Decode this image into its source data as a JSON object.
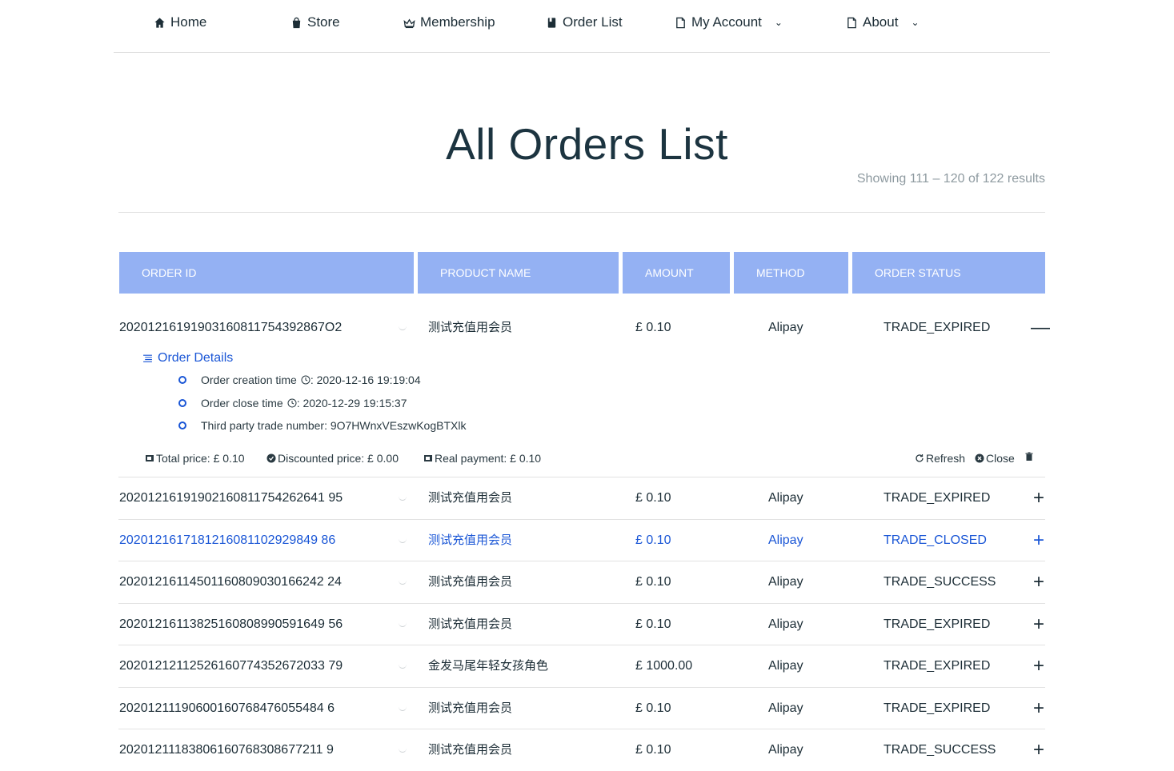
{
  "nav": {
    "home": "Home",
    "store": "Store",
    "membership": "Membership",
    "order_list": "Order List",
    "my_account": "My Account",
    "about": "About"
  },
  "page": {
    "title": "All Orders List",
    "showing": "Showing 111 – 120 of 122 results"
  },
  "table": {
    "headers": [
      "ORDER ID",
      "PRODUCT NAME",
      "AMOUNT",
      "METHOD",
      "ORDER STATUS"
    ],
    "rows": [
      {
        "id": "20201216191903160811754392867O2",
        "product": "测试充值用会员",
        "amount": "£ 0.10",
        "method": "Alipay",
        "status": "TRADE_EXPIRED",
        "toggle": "—"
      },
      {
        "id": "20201216191902160811754262641 95",
        "product": "测试充值用会员",
        "amount": "£ 0.10",
        "method": "Alipay",
        "status": "TRADE_EXPIRED",
        "toggle": "+"
      },
      {
        "id": "2020121617181216081102929849 86",
        "product": "测试充值用会员",
        "amount": "£ 0.10",
        "method": "Alipay",
        "status": "TRADE_CLOSED",
        "toggle": "+"
      },
      {
        "id": "20201216114501160809030166242 24",
        "product": "测试充值用会员",
        "amount": "£ 0.10",
        "method": "Alipay",
        "status": "TRADE_SUCCESS",
        "toggle": "+"
      },
      {
        "id": "20201216113825160808990591649 56",
        "product": "测试充值用会员",
        "amount": "£ 0.10",
        "method": "Alipay",
        "status": "TRADE_EXPIRED",
        "toggle": "+"
      },
      {
        "id": "20201212112526160774352672033 79",
        "product": "金发马尾年轻女孩角色",
        "amount": "£ 1000.00",
        "method": "Alipay",
        "status": "TRADE_EXPIRED",
        "toggle": "+"
      },
      {
        "id": "20201211190600160768476055484 6",
        "product": "测试充值用会员",
        "amount": "£ 0.10",
        "method": "Alipay",
        "status": "TRADE_EXPIRED",
        "toggle": "+"
      },
      {
        "id": "20201211183806160768308677211 9",
        "product": "测试充值用会员",
        "amount": "£ 0.10",
        "method": "Alipay",
        "status": "TRADE_SUCCESS",
        "toggle": "+"
      }
    ]
  },
  "details": {
    "heading": "Order Details",
    "creation_label": "Order creation time",
    "creation_value": ": 2020-12-16 19:19:04",
    "close_label": "Order close time",
    "close_value": ": 2020-12-29 19:15:37",
    "trade_no": "Third party trade number: 9O7HWnxVEszwKogBTXlk",
    "total_price": "Total price: £ 0.10",
    "discounted_price": "Discounted price: £ 0.00",
    "real_payment": "Real payment: £ 0.10",
    "refresh": "Refresh",
    "close": "Close"
  },
  "colors": {
    "accent": "#1a56d6",
    "header_bg": "#94b1f3",
    "text": "#1c2d36"
  }
}
